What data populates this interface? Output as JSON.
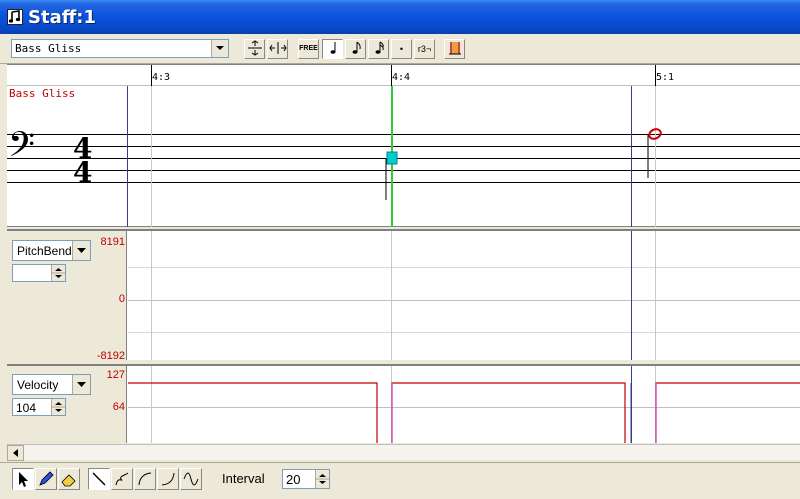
{
  "window": {
    "title": "Staff:1"
  },
  "toolbar": {
    "staff_select": "Bass Gliss",
    "free_label": "FREE",
    "triplet_label": "r3¬",
    "dot_label": "•"
  },
  "ruler": {
    "ticks": [
      "4:3",
      "4:4",
      "5:1"
    ]
  },
  "staff": {
    "name": "Bass Gliss",
    "time_signature_top": "4",
    "time_signature_bottom": "4",
    "cursor_color": "#33cc33",
    "note_color": "#00cccc",
    "next_note_color": "#cc0000"
  },
  "pitchbend": {
    "controller": "PitchBend",
    "value": "",
    "max_label": "8191",
    "mid_label": "0",
    "min_label": "-8192"
  },
  "velocity": {
    "controller": "Velocity",
    "value": "104",
    "max_label": "127",
    "mid_label": "64"
  },
  "bottom": {
    "interval_label": "Interval",
    "interval_value": "20"
  }
}
